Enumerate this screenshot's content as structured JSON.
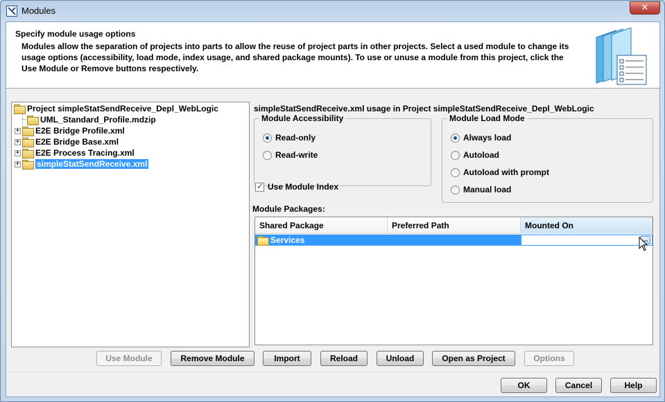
{
  "window": {
    "title": "Modules",
    "close_label": "✕"
  },
  "header": {
    "title": "Specify module usage options",
    "description": "Modules allow the separation of projects into parts to allow the reuse of project parts in other projects. Select a used module to change its usage options (accessibility, load mode, index usage, and shared package mounts). To use or unuse a module from this project, click the Use Module or Remove buttons respectively."
  },
  "tree": {
    "root": "Project simpleStatSendReceive_Depl_WebLogic",
    "items": [
      {
        "label": "UML_Standard_Profile.mdzip",
        "expandable": false
      },
      {
        "label": "E2E Bridge Profile.xml",
        "expandable": true
      },
      {
        "label": "E2E Bridge Base.xml",
        "expandable": true
      },
      {
        "label": "E2E Process Tracing.xml",
        "expandable": true
      },
      {
        "label": "simpleStatSendReceive.xml",
        "expandable": true,
        "selected": true
      }
    ],
    "expand_glyph": "+"
  },
  "usage": {
    "label": "simpleStatSendReceive.xml usage in Project simpleStatSendReceive_Depl_WebLogic",
    "accessibility": {
      "title": "Module Accessibility",
      "options": [
        "Read-only",
        "Read-write"
      ],
      "selected": "Read-only"
    },
    "load_mode": {
      "title": "Module Load Mode",
      "options": [
        "Always load",
        "Autoload",
        "Autoload with prompt",
        "Manual load"
      ],
      "selected": "Always load"
    },
    "use_module_index": {
      "label": "Use Module Index",
      "checked": true
    }
  },
  "packages": {
    "label": "Module Packages:",
    "columns": [
      "Shared Package",
      "Preferred Path",
      "Mounted On"
    ],
    "rows": [
      {
        "shared_package": "Services",
        "preferred_path": "",
        "mounted_on": ""
      }
    ],
    "ellipsis": "..."
  },
  "actions": {
    "use_module": "Use Module",
    "remove_module": "Remove Module",
    "import": "Import",
    "reload": "Reload",
    "unload": "Unload",
    "open_as_project": "Open as Project",
    "options": "Options"
  },
  "footer": {
    "ok": "OK",
    "cancel": "Cancel",
    "help": "Help"
  },
  "colors": {
    "selection": "#3399ff",
    "close_button": "#c75050"
  }
}
